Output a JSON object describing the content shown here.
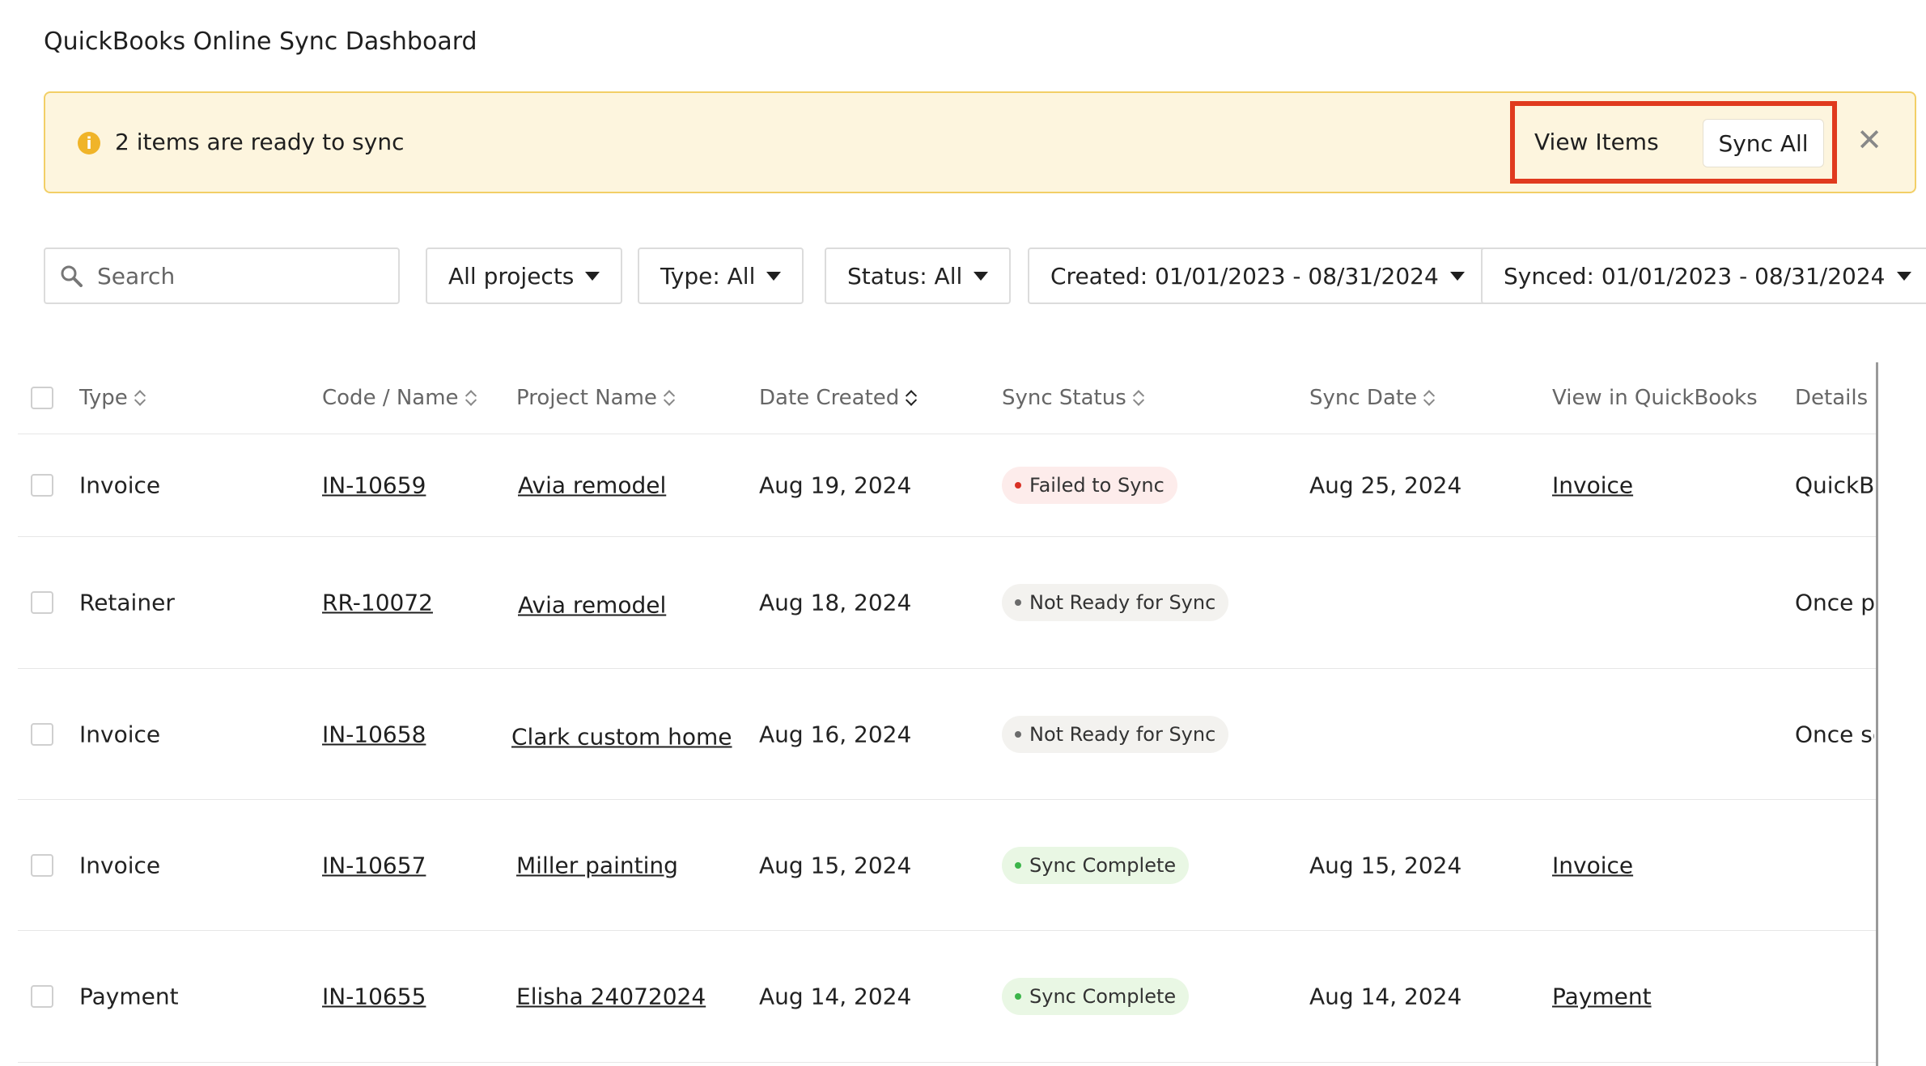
{
  "page": {
    "title": "QuickBooks Online Sync Dashboard"
  },
  "banner": {
    "message": "2 items are ready to sync",
    "view_items_label": "View Items",
    "sync_all_label": "Sync All",
    "close_glyph": "✕",
    "info_glyph": "i",
    "highlight_color": "#e03a1e"
  },
  "filters": {
    "search_placeholder": "Search",
    "projects": "All projects",
    "type": "Type: All",
    "status": "Status: All",
    "created": "Created: 01/01/2023 - 08/31/2024",
    "synced": "Synced: 01/01/2023 - 08/31/2024"
  },
  "table": {
    "headers": [
      "Type",
      "Code / Name",
      "Project Name",
      "Date Created",
      "Sync Status",
      "Sync Date",
      "View in QuickBooks",
      "Details"
    ],
    "rows": [
      {
        "type": "Invoice",
        "code": "IN-10659",
        "project": "Avia remodel",
        "created": "Aug 19, 2024",
        "status": "Failed to Sync",
        "status_kind": "failed",
        "sync_date": "Aug 25, 2024",
        "view": "Invoice",
        "details": "QuickBo"
      },
      {
        "type": "Retainer",
        "code": "RR-10072",
        "project": "Avia remodel",
        "created": "Aug 18, 2024",
        "status": "Not Ready for Sync",
        "status_kind": "notready",
        "sync_date": "",
        "view": "",
        "details": "Once pa"
      },
      {
        "type": "Invoice",
        "code": "IN-10658",
        "project": "Clark custom home",
        "created": "Aug 16, 2024",
        "status": "Not Ready for Sync",
        "status_kind": "notready",
        "sync_date": "",
        "view": "",
        "details": "Once se"
      },
      {
        "type": "Invoice",
        "code": "IN-10657",
        "project": "Miller painting",
        "created": "Aug 15, 2024",
        "status": "Sync Complete",
        "status_kind": "complete",
        "sync_date": "Aug 15, 2024",
        "view": "Invoice",
        "details": ""
      },
      {
        "type": "Payment",
        "code": "IN-10655",
        "project": "Elisha 24072024",
        "created": "Aug 14, 2024",
        "status": "Sync Complete",
        "status_kind": "complete",
        "sync_date": "Aug 14, 2024",
        "view": "Payment",
        "details": ""
      }
    ]
  }
}
